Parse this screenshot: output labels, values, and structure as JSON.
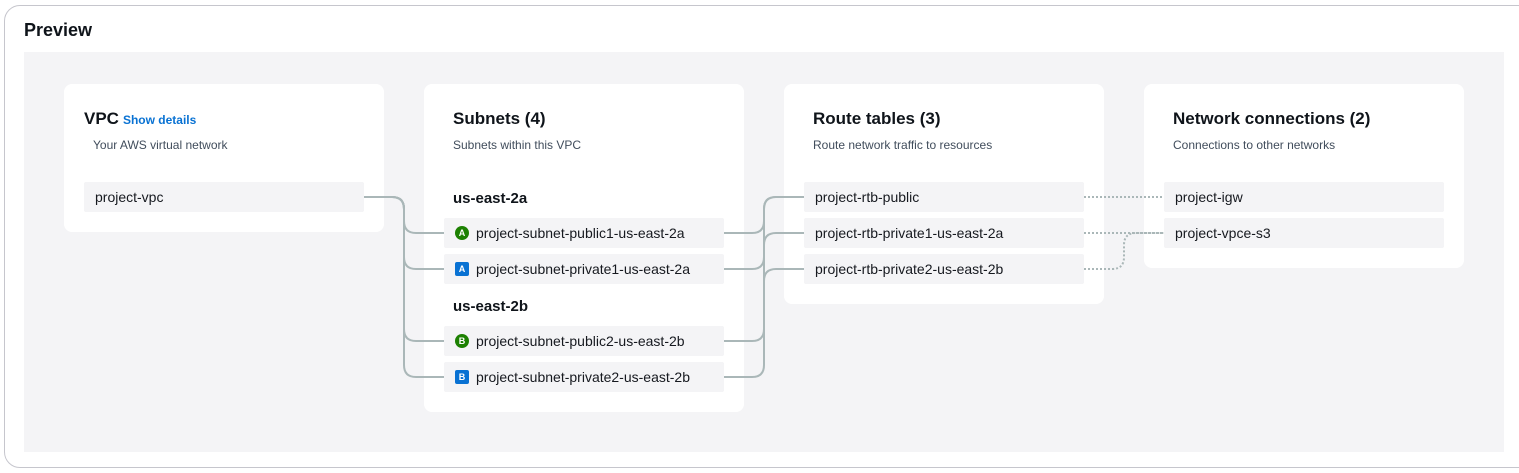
{
  "title": "Preview",
  "vpc": {
    "title": "VPC",
    "show_details": "Show details",
    "subtitle": "Your AWS virtual network",
    "item": "project-vpc"
  },
  "subnets": {
    "title": "Subnets (4)",
    "subtitle": "Subnets within this VPC",
    "groups": [
      {
        "label": "us-east-2a",
        "items": [
          {
            "badge": "A",
            "kind": "public",
            "name": "project-subnet-public1-us-east-2a"
          },
          {
            "badge": "A",
            "kind": "private",
            "name": "project-subnet-private1-us-east-2a"
          }
        ]
      },
      {
        "label": "us-east-2b",
        "items": [
          {
            "badge": "B",
            "kind": "public",
            "name": "project-subnet-public2-us-east-2b"
          },
          {
            "badge": "B",
            "kind": "private",
            "name": "project-subnet-private2-us-east-2b"
          }
        ]
      }
    ]
  },
  "route_tables": {
    "title": "Route tables (3)",
    "subtitle": "Route network traffic to resources",
    "items": [
      "project-rtb-public",
      "project-rtb-private1-us-east-2a",
      "project-rtb-private2-us-east-2b"
    ]
  },
  "network_connections": {
    "title": "Network connections (2)",
    "subtitle": "Connections to other networks",
    "items": [
      "project-igw",
      "project-vpce-s3"
    ]
  },
  "colors": {
    "solid_line": "#aab7b8",
    "dotted_line": "#aab7b8",
    "public_badge": "#1d8102",
    "private_badge": "#0972d3",
    "link": "#0972d3"
  }
}
